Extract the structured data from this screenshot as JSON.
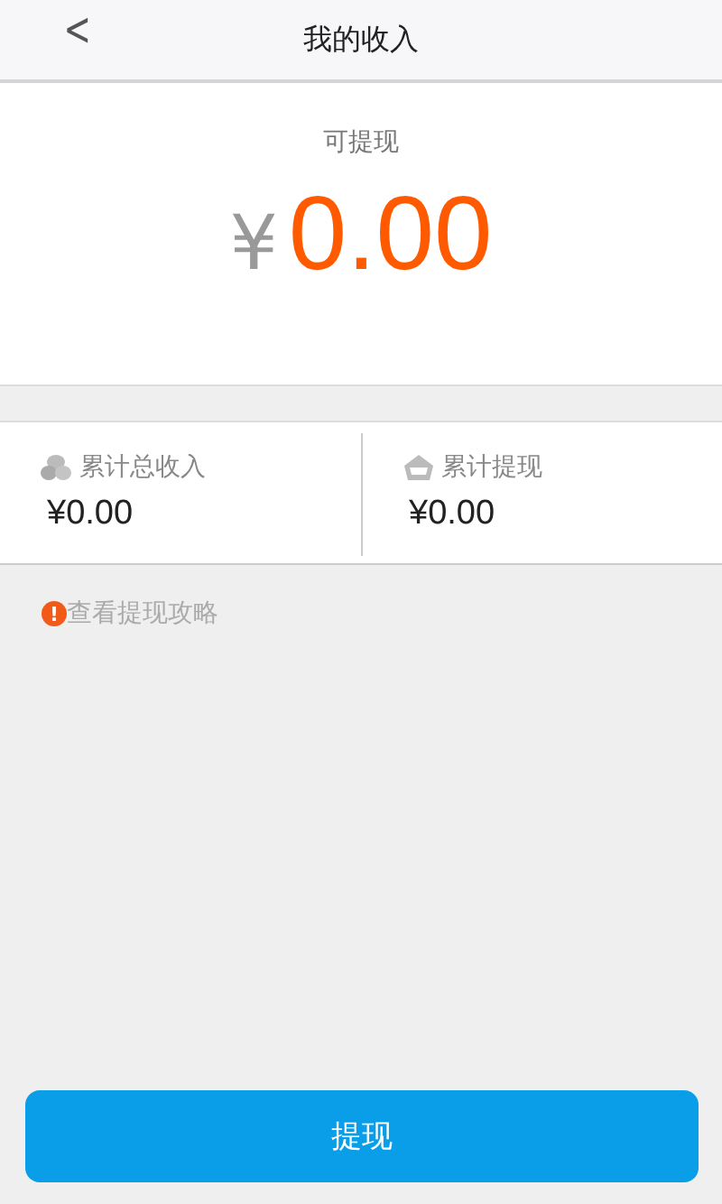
{
  "header": {
    "back": "<",
    "title": "我的收入"
  },
  "balance": {
    "label": "可提现",
    "currency": "¥",
    "amount": "0.00"
  },
  "stats": [
    {
      "kind": "coins",
      "label": "累计总收入",
      "value": "¥0.00"
    },
    {
      "kind": "box",
      "label": "累计提现",
      "value": "¥0.00"
    }
  ],
  "guide_link": {
    "icon": "!",
    "text": "查看提现攻略"
  },
  "withdraw_button": "提现"
}
